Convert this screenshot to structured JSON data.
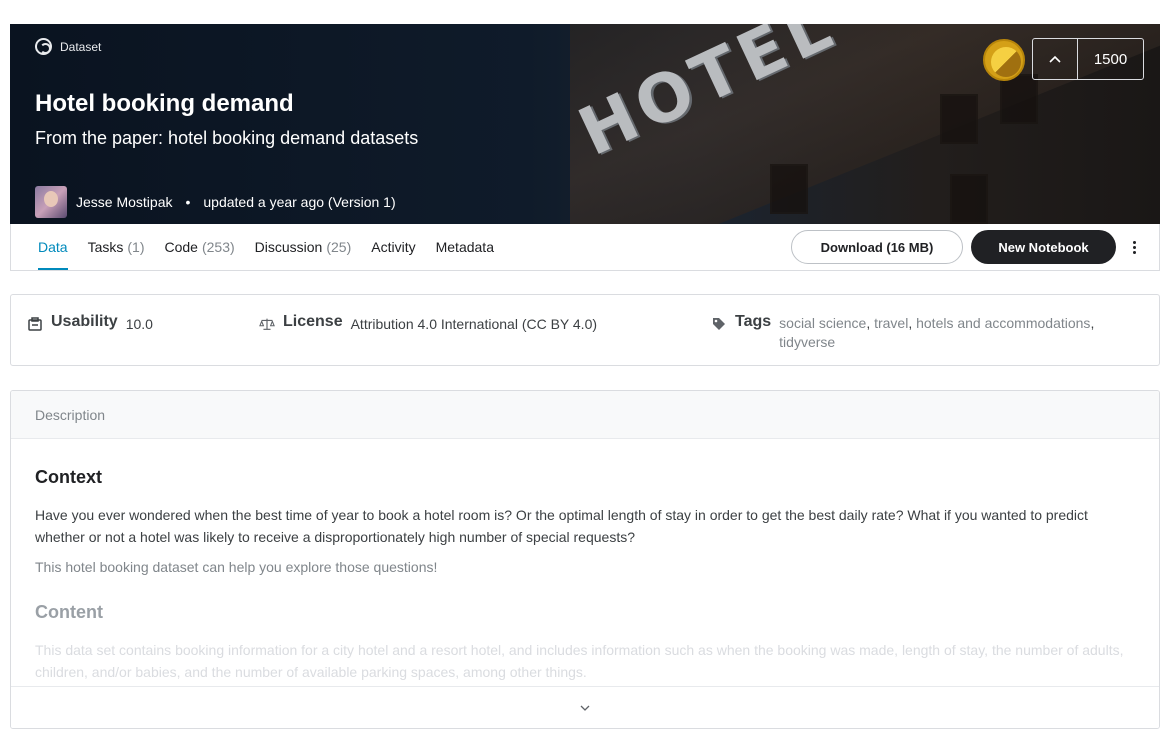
{
  "header": {
    "type_label": "Dataset",
    "title": "Hotel booking demand",
    "subtitle": "From the paper: hotel booking demand datasets",
    "owner": "Jesse Mostipak",
    "updated": "updated a year ago (Version 1)",
    "votes": "1500",
    "banner_sign_text": "HOTEL",
    "colors": {
      "banner_bg": "#0f1b2a",
      "medal": "#d4a017"
    }
  },
  "tabs": [
    {
      "label": "Data",
      "count": "",
      "active": true
    },
    {
      "label": "Tasks",
      "count": "(1)",
      "active": false
    },
    {
      "label": "Code",
      "count": "(253)",
      "active": false
    },
    {
      "label": "Discussion",
      "count": "(25)",
      "active": false
    },
    {
      "label": "Activity",
      "count": "",
      "active": false
    },
    {
      "label": "Metadata",
      "count": "",
      "active": false
    }
  ],
  "actions": {
    "download_label": "Download (16 MB)",
    "new_notebook_label": "New Notebook"
  },
  "metrics": {
    "usability_label": "Usability",
    "usability_value": "10.0",
    "license_label": "License",
    "license_value": "Attribution 4.0 International (CC BY 4.0)",
    "tags_label": "Tags",
    "tags": [
      "social science",
      "travel",
      "hotels and accommodations",
      "tidyverse"
    ]
  },
  "description": {
    "section_label": "Description",
    "context_heading": "Context",
    "context_p1": "Have you ever wondered when the best time of year to book a hotel room is? Or the optimal length of stay in order to get the best daily rate? What if you wanted to predict whether or not a hotel was likely to receive a disproportionately high number of special requests?",
    "context_p2": "This hotel booking dataset can help you explore those questions!",
    "content_heading": "Content",
    "content_p1": "This data set contains booking information for a city hotel and a resort hotel, and includes information such as when the booking was made, length of stay, the number of adults, children, and/or babies, and the number of available parking spaces, among other things."
  },
  "icons": [
    "dataset-icon",
    "chevron-up-icon",
    "more-vert-icon",
    "usability-icon",
    "license-icon",
    "tag-icon",
    "chevron-down-icon"
  ]
}
